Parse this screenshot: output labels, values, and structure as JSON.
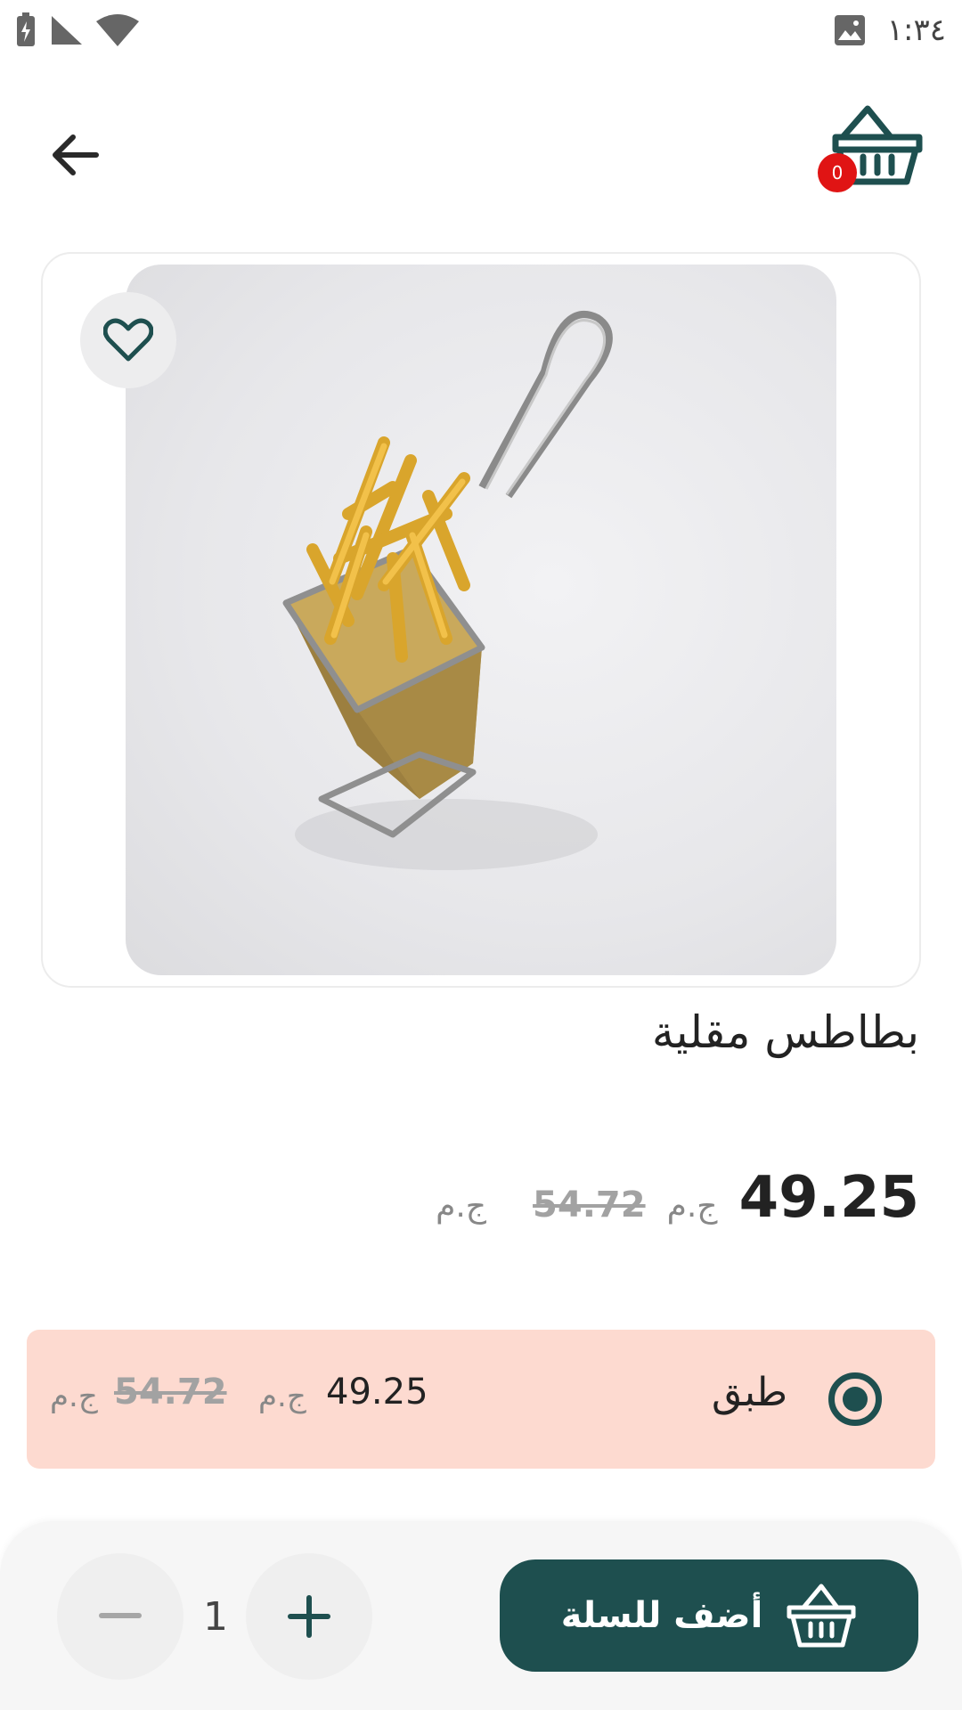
{
  "status_bar": {
    "time": "١:٣٤",
    "icons": [
      "battery-charging-icon",
      "cell-signal-icon",
      "wifi-icon",
      "image-notification-icon"
    ]
  },
  "header": {
    "back_icon": "arrow-left-icon",
    "cart_icon": "basket-icon",
    "cart_count": "0"
  },
  "product": {
    "image_alt": "fries-basket-photo",
    "favorite_icon": "heart-icon",
    "title": "بطاطس مقلية",
    "price": "49.25",
    "currency": "ج.م",
    "old_price": "54.72",
    "old_currency": "ج.م"
  },
  "variant": {
    "selected": true,
    "label": "طبق",
    "price": "49.25",
    "currency": "ج.م",
    "old_price": "54.72",
    "old_currency": "ج.م"
  },
  "bottom_bar": {
    "quantity": "1",
    "minus_icon": "minus-icon",
    "plus_icon": "plus-icon",
    "add_to_cart_label": "أضف للسلة",
    "add_icon": "basket-icon"
  },
  "colors": {
    "primary": "#1e4f4f",
    "badge": "#e01414",
    "variant_bg": "#fddad0"
  }
}
